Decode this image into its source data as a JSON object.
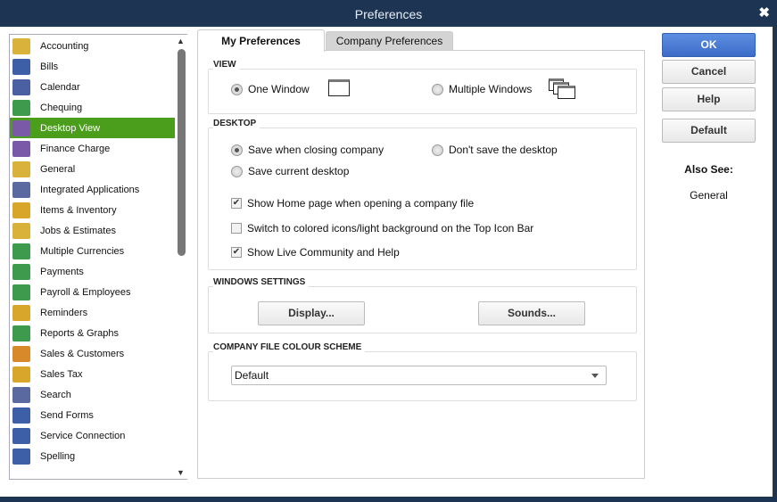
{
  "window": {
    "title": "Preferences",
    "close": "✖"
  },
  "sidebar": {
    "items": [
      {
        "label": "Accounting",
        "icon": "accounting-icon",
        "color": "#d8b23a"
      },
      {
        "label": "Bills",
        "icon": "bills-icon",
        "color": "#3d5fa8"
      },
      {
        "label": "Calendar",
        "icon": "calendar-icon",
        "color": "#4b5fa3"
      },
      {
        "label": "Chequing",
        "icon": "chequing-icon",
        "color": "#3e9a4c"
      },
      {
        "label": "Desktop View",
        "icon": "desktop-view-icon",
        "color": "#7a5aa8",
        "selected": true
      },
      {
        "label": "Finance Charge",
        "icon": "finance-charge-icon",
        "color": "#7a5aa8"
      },
      {
        "label": "General",
        "icon": "general-icon",
        "color": "#d8b23a"
      },
      {
        "label": "Integrated Applications",
        "icon": "integrated-applications-icon",
        "color": "#5a6aa0"
      },
      {
        "label": "Items & Inventory",
        "icon": "items-inventory-icon",
        "color": "#d8a62a"
      },
      {
        "label": "Jobs & Estimates",
        "icon": "jobs-estimates-icon",
        "color": "#d8b23a"
      },
      {
        "label": "Multiple Currencies",
        "icon": "multiple-currencies-icon",
        "color": "#3e9a4c"
      },
      {
        "label": "Payments",
        "icon": "payments-icon",
        "color": "#3e9a4c"
      },
      {
        "label": "Payroll & Employees",
        "icon": "payroll-employees-icon",
        "color": "#3e9a4c"
      },
      {
        "label": "Reminders",
        "icon": "reminders-icon",
        "color": "#d8a62a"
      },
      {
        "label": "Reports & Graphs",
        "icon": "reports-graphs-icon",
        "color": "#3e9a4c"
      },
      {
        "label": "Sales & Customers",
        "icon": "sales-customers-icon",
        "color": "#d88a2a"
      },
      {
        "label": "Sales Tax",
        "icon": "sales-tax-icon",
        "color": "#d8a62a"
      },
      {
        "label": "Search",
        "icon": "search-icon",
        "color": "#5a6aa0"
      },
      {
        "label": "Send Forms",
        "icon": "send-forms-icon",
        "color": "#3d5fa8"
      },
      {
        "label": "Service Connection",
        "icon": "service-connection-icon",
        "color": "#3d5fa8"
      },
      {
        "label": "Spelling",
        "icon": "spelling-icon",
        "color": "#3d5fa8"
      }
    ]
  },
  "tabs": {
    "my": "My Preferences",
    "company": "Company Preferences"
  },
  "view": {
    "label": "VIEW",
    "one": "One Window",
    "multiple": "Multiple Windows"
  },
  "desktop": {
    "label": "DESKTOP",
    "save_closing": "Save when closing company",
    "dont_save": "Don't save the desktop",
    "save_current": "Save current desktop",
    "show_home": "Show Home page when opening a company file",
    "switch_icons": "Switch to colored icons/light background on the Top Icon Bar",
    "show_live": "Show Live Community and Help"
  },
  "windows_settings": {
    "label": "WINDOWS SETTINGS",
    "display": "Display...",
    "sounds": "Sounds..."
  },
  "colour_scheme": {
    "label": "COMPANY FILE COLOUR SCHEME",
    "value": "Default"
  },
  "buttons": {
    "ok": "OK",
    "cancel": "Cancel",
    "help": "Help",
    "default": "Default"
  },
  "also_see": {
    "title": "Also See:",
    "link": "General"
  }
}
